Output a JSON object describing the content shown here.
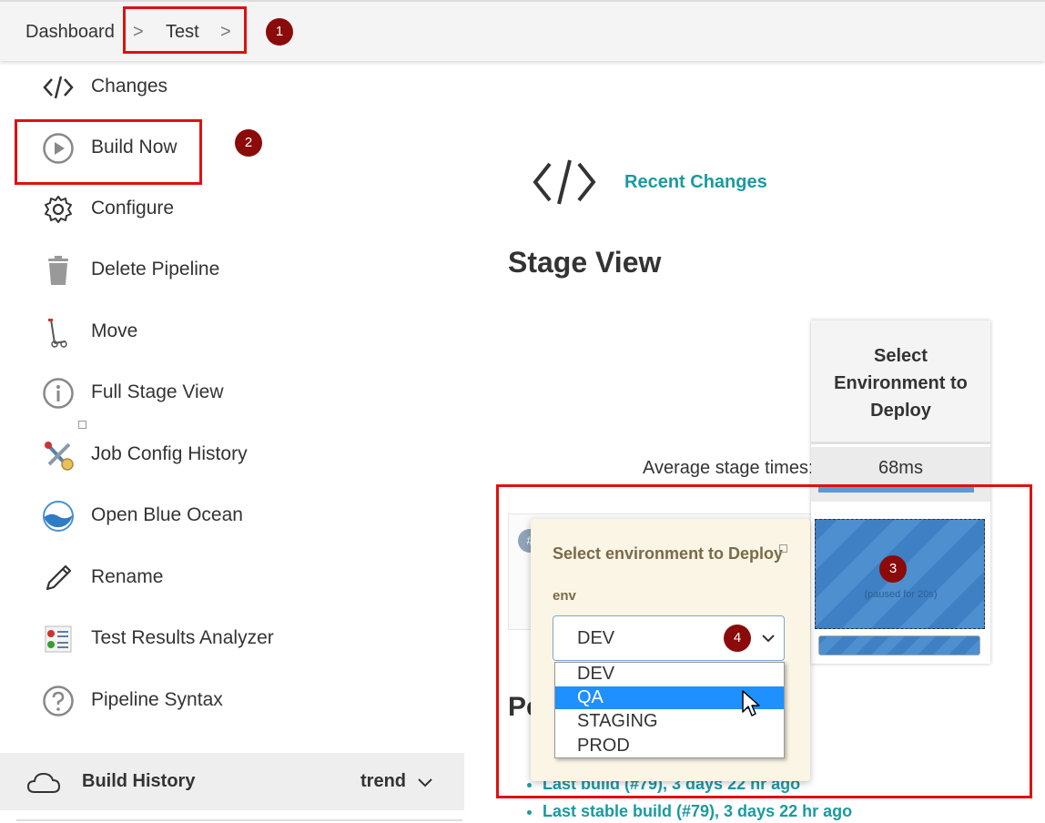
{
  "breadcrumb": {
    "items": [
      "Dashboard",
      "Test"
    ],
    "separator": ">"
  },
  "callouts": [
    "1",
    "2",
    "3",
    "4"
  ],
  "sidebar": {
    "items": [
      {
        "label": "Changes",
        "icon": "code-icon"
      },
      {
        "label": "Build Now",
        "icon": "play-icon"
      },
      {
        "label": "Configure",
        "icon": "gear-icon"
      },
      {
        "label": "Delete Pipeline",
        "icon": "trash-icon"
      },
      {
        "label": "Move",
        "icon": "hand-truck-icon"
      },
      {
        "label": "Full Stage View",
        "icon": "info-icon"
      },
      {
        "label": "Job Config History",
        "icon": "tools-icon"
      },
      {
        "label": "Open Blue Ocean",
        "icon": "blue-ocean-icon"
      },
      {
        "label": "Rename",
        "icon": "pencil-icon"
      },
      {
        "label": "Test Results Analyzer",
        "icon": "test-results-icon"
      },
      {
        "label": "Pipeline Syntax",
        "icon": "help-icon"
      }
    ],
    "build_history": {
      "label": "Build History",
      "trend": "trend"
    }
  },
  "main": {
    "recent_changes": "Recent Changes",
    "stage_view_title": "Stage View",
    "avg_label": "Average stage times:",
    "stage": {
      "name": "Select Environment to Deploy",
      "avg_time": "68ms",
      "paused_text": "(paused for 20s)"
    },
    "run_badge": "#",
    "permalinks_heading": "Pe",
    "permalinks": [
      "Last build (#79), 3 days 22 hr ago",
      "Last stable build (#79), 3 days 22 hr ago"
    ]
  },
  "popup": {
    "title": "Select environment to Deploy",
    "field_label": "env",
    "selected_value": "DEV",
    "options": [
      "DEV",
      "QA",
      "STAGING",
      "PROD"
    ],
    "highlighted_option": "QA"
  },
  "colors": {
    "annotation_red": "#e01010",
    "callout": "#8b0a0a",
    "link": "#1a9aa0",
    "stage_blue": "#4e8fd0",
    "popup_bg": "#faf5e4",
    "highlight": "#1e90ff"
  }
}
